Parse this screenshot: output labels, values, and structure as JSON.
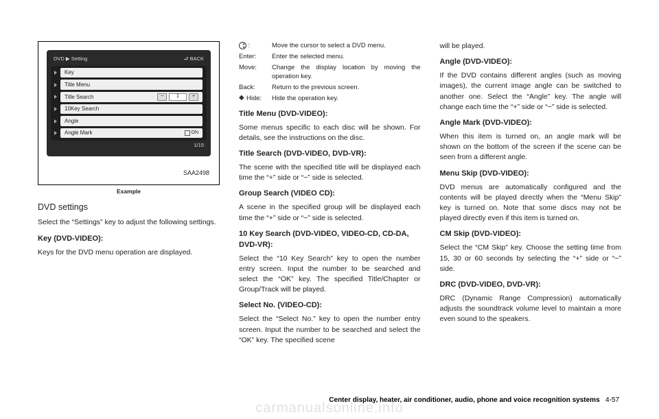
{
  "figure": {
    "breadcrumb_left": "DVD ▶ Setting",
    "breadcrumb_right": "⮐ BACK",
    "rows": {
      "key": "Key",
      "title_menu": "Title Menu",
      "title_search": "Title Search",
      "title_search_val": "1",
      "tenkey": "10Key Search",
      "angle": "Angle",
      "angle_mark": "Angle Mark",
      "on": "ON"
    },
    "page_indicator": "1/15",
    "id": "SAA2498",
    "caption": "Example"
  },
  "col1": {
    "h1": "DVD settings",
    "p1": "Select the “Settings” key to adjust the following settings.",
    "h2": "Key (DVD-VIDEO):",
    "p2": "Keys for the DVD menu operation are displayed."
  },
  "defs": {
    "k1": ":",
    "v1": "Move the cursor to select a DVD menu.",
    "k2": "Enter:",
    "v2": "Enter the selected menu.",
    "k3": "Move:",
    "v3": "Change the display location by moving the operation key.",
    "k4": "Back:",
    "v4": "Return to the previous screen.",
    "k5": "Hide:",
    "v5": "Hide the operation key."
  },
  "col2": {
    "h1": "Title Menu (DVD-VIDEO):",
    "p1": "Some menus specific to each disc will be shown. For details, see the instructions on the disc.",
    "h2": "Title Search (DVD-VIDEO, DVD-VR):",
    "p2": "The scene with the specified title will be displayed each time the “+” side or “−” side is selected.",
    "h3": "Group Search (VIDEO CD):",
    "p3": "A scene in the specified group will be displayed each time the “+” side or “−” side is selected.",
    "h4": "10 Key Search (DVD-VIDEO, VIDEO-CD, CD-DA, DVD-VR):",
    "p4": "Select the “10 Key Search” key to open the number entry screen. Input the number to be searched and select the “OK” key. The specified Title/Chapter or Group/Track will be played.",
    "h5": "Select No. (VIDEO-CD):",
    "p5": "Select the “Select No.” key to open the number entry screen. Input the number to be searched and select the “OK” key. The specified scene"
  },
  "col3": {
    "p0": "will be played.",
    "h1": "Angle (DVD-VIDEO):",
    "p1": "If the DVD contains different angles (such as moving images), the current image angle can be switched to another one. Select the “Angle” key. The angle will change each time the “+” side or “−” side is selected.",
    "h2": "Angle Mark (DVD-VIDEO):",
    "p2": "When this item is turned on, an angle mark will be shown on the bottom of the screen if the scene can be seen from a different angle.",
    "h3": "Menu Skip (DVD-VIDEO):",
    "p3": "DVD menus are automatically configured and the contents will be played directly when the “Menu Skip” key is turned on. Note that some discs may not be played directly even if this item is turned on.",
    "h4": "CM Skip (DVD-VIDEO):",
    "p4": "Select the “CM Skip” key. Choose the setting time from 15, 30 or 60 seconds by selecting the “+” side or “−” side.",
    "h5": "DRC (DVD-VIDEO, DVD-VR):",
    "p5": "DRC (Dynamic Range Compression) automatically adjusts the soundtrack volume level to maintain a more even sound to the speakers."
  },
  "footer": {
    "section": "Center display, heater, air conditioner, audio, phone and voice recognition systems",
    "page": "4-57"
  },
  "watermark": "carmanualsonline.info"
}
